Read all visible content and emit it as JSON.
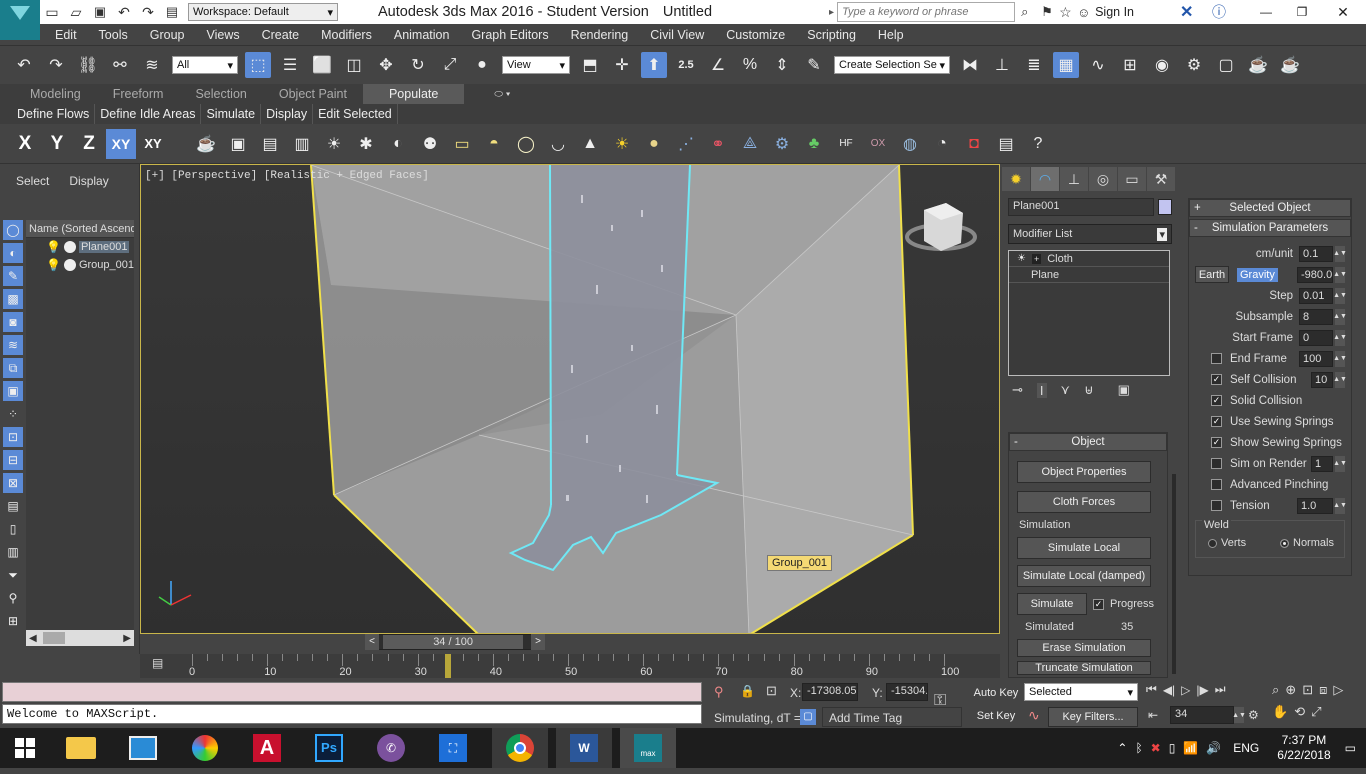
{
  "title_bar": {
    "workspace_label": "Workspace: Default",
    "app_title": "Autodesk 3ds Max 2016 - Student Version",
    "file_title": "Untitled",
    "search_placeholder": "Type a keyword or phrase",
    "sign_in": "Sign In"
  },
  "menu": {
    "items": [
      "Edit",
      "Tools",
      "Group",
      "Views",
      "Create",
      "Modifiers",
      "Animation",
      "Graph Editors",
      "Rendering",
      "Civil View",
      "Customize",
      "Scripting",
      "Help"
    ]
  },
  "toolbar": {
    "selection_filter": "All",
    "ref_coord": "View",
    "snap_angle": "2.5",
    "named_selection_placeholder": "Create Selection Se"
  },
  "ribbon": {
    "tabs": [
      "Modeling",
      "Freeform",
      "Selection",
      "Object Paint",
      "Populate"
    ],
    "active_tab": "Populate",
    "sub_items": [
      "Define Flows",
      "Define Idle Areas",
      "Simulate",
      "Display",
      "Edit Selected"
    ]
  },
  "axis_constraints": {
    "x": "X",
    "y": "Y",
    "z": "Z",
    "xy": "XY",
    "xy_alt": "XY"
  },
  "scene_explorer": {
    "tab_select": "Select",
    "tab_display": "Display",
    "column_header": "Name (Sorted Ascend",
    "objects": [
      "Plane001",
      "Group_001"
    ]
  },
  "viewport": {
    "label": "[+] [Perspective] [Realistic + Edged Faces]",
    "tooltip": "Group_001"
  },
  "timeline": {
    "frame_display": "34 / 100",
    "current_frame": 34,
    "max_frame": 100,
    "tick_labels": [
      "0",
      "10",
      "20",
      "30",
      "40",
      "50",
      "60",
      "70",
      "80",
      "90",
      "100"
    ]
  },
  "command_panel": {
    "object_name": "Plane001",
    "modifier_list": "Modifier List",
    "stack": [
      "Cloth",
      "Plane"
    ],
    "object_rollout": {
      "title": "Object",
      "buttons": [
        "Object Properties",
        "Cloth Forces"
      ],
      "simulation_group": "Simulation",
      "sim_local": "Simulate Local",
      "sim_local_damped": "Simulate Local (damped)",
      "simulate": "Simulate",
      "progress": "Progress",
      "simulated_label": "Simulated",
      "simulated_value": "35",
      "erase": "Erase Simulation",
      "truncate": "Truncate Simulation"
    },
    "selected_object_rollout": "Selected Object",
    "sim_params_rollout": "Simulation Parameters",
    "params": {
      "cm_unit_label": "cm/unit",
      "cm_unit": "0.1",
      "earth": "Earth",
      "gravity_label": "Gravity",
      "gravity": "-980.0",
      "step_label": "Step",
      "step": "0.01",
      "subsample_label": "Subsample",
      "subsample": "8",
      "start_frame_label": "Start Frame",
      "start_frame": "0",
      "end_frame_label": "End Frame",
      "end_frame": "100",
      "self_collision_label": "Self Collision",
      "self_collision": "10",
      "solid_collision_label": "Solid Collision",
      "use_sewing_label": "Use Sewing Springs",
      "show_sewing_label": "Show Sewing Springs",
      "sim_on_render_label": "Sim on Render",
      "sim_on_render": "1",
      "adv_pinching_label": "Advanced Pinching",
      "tension_label": "Tension",
      "tension": "1.0",
      "weld_label": "Weld",
      "verts": "Verts",
      "normals": "Normals"
    }
  },
  "status": {
    "maxscript_output": "Welcome to MAXScript.",
    "x_label": "X:",
    "x_value": "-17308.059",
    "y_label": "Y:",
    "y_value": "-15304.",
    "simulating": "Simulating, dT =",
    "add_time_tag": "Add Time Tag",
    "auto_key": "Auto Key",
    "set_key": "Set Key",
    "key_mode": "Selected",
    "key_filters": "Key Filters...",
    "frame_field": "34"
  },
  "taskbar": {
    "language": "ENG",
    "time": "7:37 PM",
    "date": "6/22/2018",
    "apps": [
      "file-explorer",
      "photos",
      "color-app",
      "autocad",
      "photoshop",
      "viber",
      "screen-capture",
      "chrome",
      "word",
      "3dsmax"
    ]
  },
  "colors": {
    "accent_blue": "#5b8ad6",
    "viewport_border": "#c9b64a",
    "selection_cyan": "#6fe8f5",
    "group_outline": "#f0e04a"
  }
}
